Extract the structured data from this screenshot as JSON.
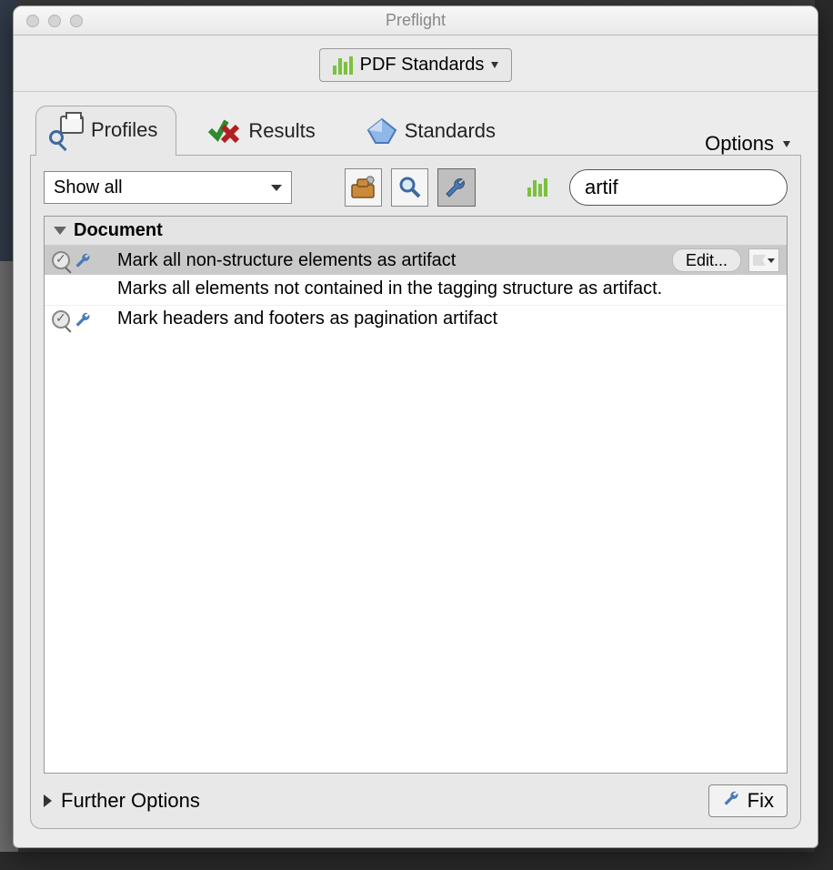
{
  "window": {
    "title": "Preflight"
  },
  "toolbar": {
    "pdf_standards_label": "PDF Standards",
    "options_label": "Options"
  },
  "tabs": {
    "profiles": "Profiles",
    "results": "Results",
    "standards": "Standards"
  },
  "filter": {
    "selected": "Show all"
  },
  "search": {
    "value": "artif"
  },
  "group": {
    "title": "Document"
  },
  "fixups": [
    {
      "title": "Mark all non-structure elements as artifact",
      "description": "Marks all elements not contained in the tagging structure as artifact.",
      "edit_label": "Edit...",
      "selected": true
    },
    {
      "title": "Mark headers and footers as pagination artifact",
      "selected": false
    }
  ],
  "footer": {
    "further_options": "Further Options",
    "fix_label": "Fix"
  }
}
